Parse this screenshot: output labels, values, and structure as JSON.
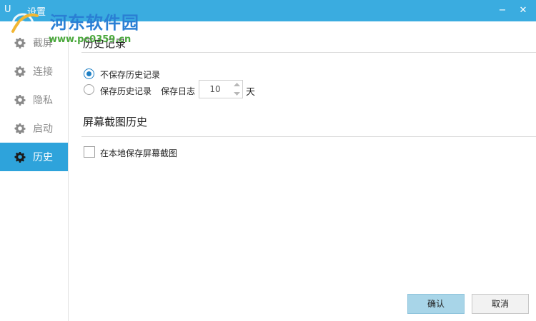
{
  "window": {
    "app_short": "U",
    "title": "设置",
    "minimize": "−",
    "close": "✕"
  },
  "watermark": {
    "site_name": "河东软件园",
    "url": "www.pc0359.cn"
  },
  "sidebar": {
    "items": [
      {
        "label": "截屏",
        "icon": "gear-icon",
        "active": false
      },
      {
        "label": "连接",
        "icon": "gear-icon",
        "active": false
      },
      {
        "label": "隐私",
        "icon": "gear-icon",
        "active": false
      },
      {
        "label": "启动",
        "icon": "gear-icon",
        "active": false
      },
      {
        "label": "历史",
        "icon": "gear-icon",
        "active": true
      }
    ]
  },
  "history": {
    "title": "历史记录",
    "option_no_save": "不保存历史记录",
    "option_save": "保存历史记录",
    "selected": "no_save",
    "log_label": "保存日志",
    "log_days": "10",
    "days_unit": "天"
  },
  "screenshot_history": {
    "title": "屏幕截图历史",
    "save_local_label": "在本地保存屏幕截图",
    "save_local_checked": false
  },
  "buttons": {
    "confirm": "确认",
    "cancel": "取消"
  },
  "colors": {
    "titlebar": "#3aace0",
    "active_nav": "#2ea3db",
    "radio_accent": "#1e7fc4",
    "confirm_bg": "#a8d5e8"
  }
}
